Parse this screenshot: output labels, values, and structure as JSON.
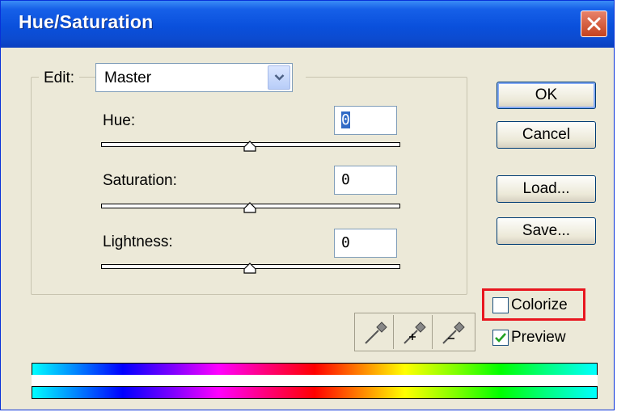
{
  "window": {
    "title": "Hue/Saturation"
  },
  "edit": {
    "label": "Edit:",
    "selected": "Master"
  },
  "sliders": [
    {
      "label": "Hue:",
      "value": "0",
      "position": 0.5
    },
    {
      "label": "Saturation:",
      "value": "0",
      "position": 0.5
    },
    {
      "label": "Lightness:",
      "value": "0",
      "position": 0.5
    }
  ],
  "buttons": {
    "ok": "OK",
    "cancel": "Cancel",
    "load": "Load...",
    "save": "Save..."
  },
  "checkboxes": {
    "colorize": {
      "label": "Colorize",
      "checked": false
    },
    "preview": {
      "label": "Preview",
      "checked": true
    }
  },
  "icons": [
    "close-icon",
    "chevron-down-icon",
    "eyedropper-icon",
    "eyedropper-plus-icon",
    "eyedropper-minus-icon",
    "check-icon"
  ],
  "colors": {
    "titlebar": "#0a50dc",
    "highlight": "#e8161f",
    "dialog_bg": "#ece9d8"
  }
}
